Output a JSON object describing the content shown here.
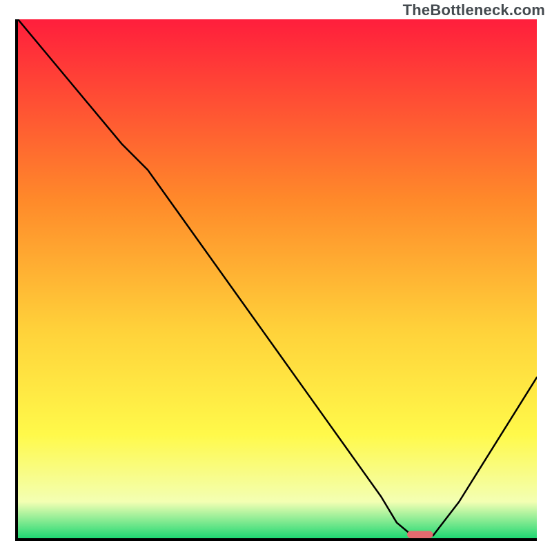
{
  "watermark": "TheBottleneck.com",
  "colors": {
    "gradient_top": "#ff1e3c",
    "gradient_mid_upper": "#ff8a2a",
    "gradient_mid": "#ffd23a",
    "gradient_mid_lower": "#fff94a",
    "gradient_band": "#f3ffb3",
    "gradient_bottom": "#1fd873",
    "curve": "#000000",
    "marker": "#e46a6f",
    "axis": "#000000"
  },
  "chart_data": {
    "type": "line",
    "title": "",
    "xlabel": "",
    "ylabel": "",
    "xlim": [
      0,
      100
    ],
    "ylim": [
      0,
      100
    ],
    "grid": false,
    "legend": false,
    "series": [
      {
        "name": "bottleneck-curve",
        "x": [
          0,
          5,
          10,
          15,
          20,
          25,
          30,
          35,
          40,
          45,
          50,
          55,
          60,
          65,
          70,
          73,
          76,
          78,
          80,
          85,
          90,
          95,
          100
        ],
        "y": [
          100,
          94,
          88,
          82,
          76,
          71,
          64,
          57,
          50,
          43,
          36,
          29,
          22,
          15,
          8,
          3,
          0.5,
          0.5,
          0.5,
          7,
          15,
          23,
          31
        ]
      }
    ],
    "marker": {
      "name": "optimal-range",
      "x_start": 75,
      "x_end": 80,
      "y": 0.7,
      "color": "#e46a6f"
    }
  }
}
